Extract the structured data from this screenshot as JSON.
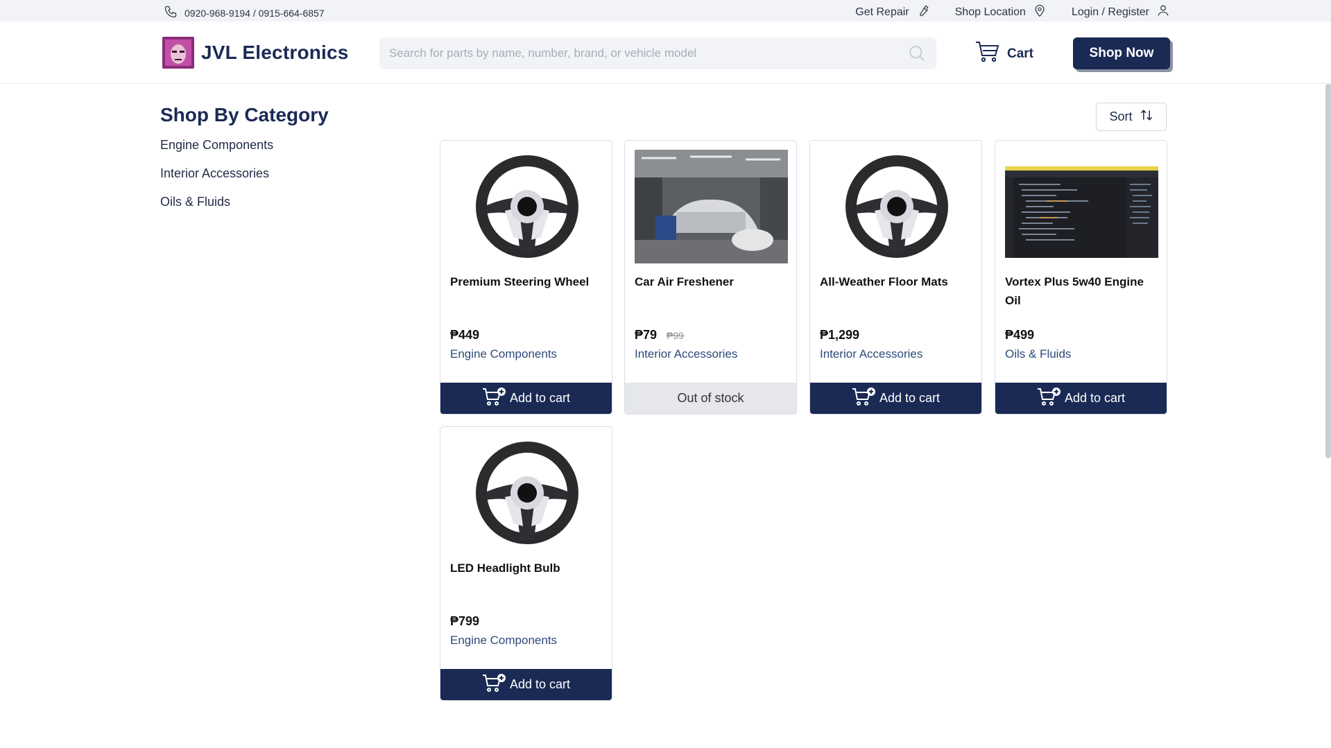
{
  "topbar": {
    "phone": "0920-968-9194 / 0915-664-6857",
    "links": [
      {
        "label": "Get Repair",
        "icon": "wrench-icon"
      },
      {
        "label": "Shop Location",
        "icon": "map-pin-icon"
      },
      {
        "label": "Login / Register",
        "icon": "user-icon"
      }
    ]
  },
  "header": {
    "brand": "JVL Electronics",
    "search_placeholder": "Search for parts by name, number, brand, or vehicle model",
    "cart_label": "Cart",
    "shop_now_label": "Shop Now"
  },
  "sidebar": {
    "title": "Shop By Category",
    "categories": [
      "Engine Components",
      "Interior Accessories",
      "Oils & Fluids"
    ]
  },
  "sort_label": "Sort",
  "products": [
    {
      "name": "Premium Steering Wheel",
      "price": "₱449",
      "old_price": "",
      "category": "Engine Components",
      "button": "Add to cart",
      "image": "steering-wheel"
    },
    {
      "name": "Car Air Freshener",
      "price": "₱79",
      "old_price": "₱99",
      "category": "Interior Accessories",
      "button": "Out of stock",
      "image": "garage-photo"
    },
    {
      "name": "All-Weather Floor Mats",
      "price": "₱1,299",
      "old_price": "",
      "category": "Interior Accessories",
      "button": "Add to cart",
      "image": "steering-wheel"
    },
    {
      "name": "Vortex Plus 5w40 Engine Oil",
      "price": "₱499",
      "old_price": "",
      "category": "Oils & Fluids",
      "button": "Add to cart",
      "image": "code-screenshot"
    },
    {
      "name": "LED Headlight Bulb",
      "price": "₱799",
      "old_price": "",
      "category": "Engine Components",
      "button": "Add to cart",
      "image": "steering-wheel"
    }
  ],
  "colors": {
    "brand": "#1a2a55",
    "topbar_bg": "#f1f3f6",
    "category_text": "#2c4a7a"
  }
}
